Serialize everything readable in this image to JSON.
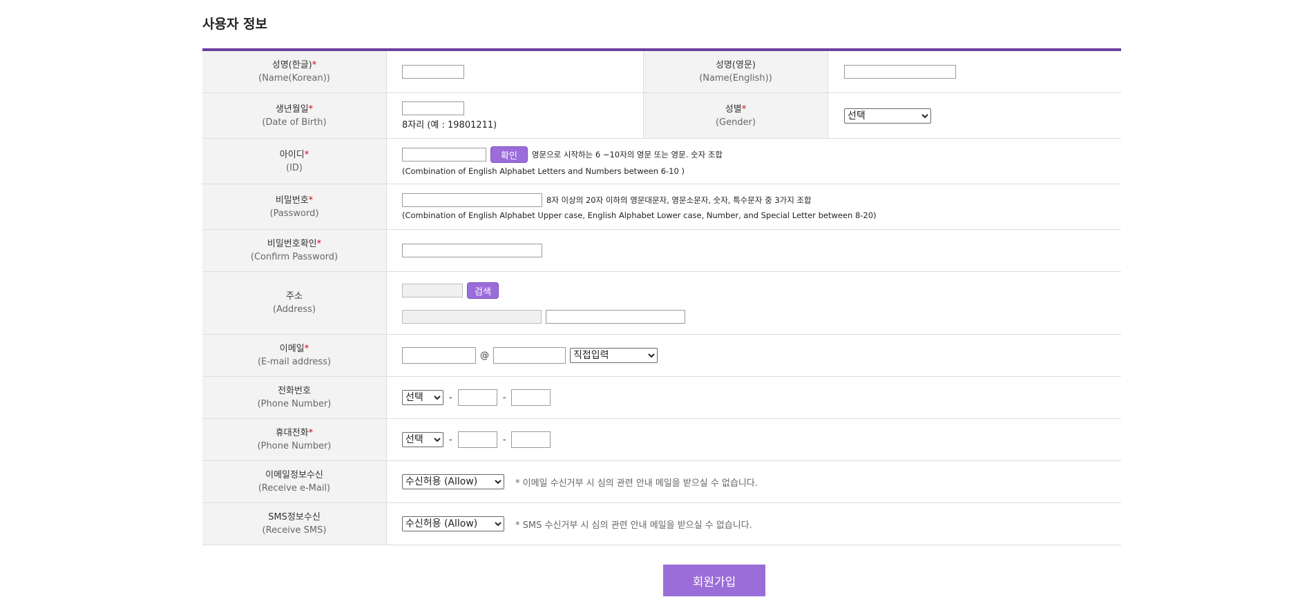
{
  "section_title": "사용자 정보",
  "required_mark": "*",
  "rows": {
    "name_kr": {
      "label": "성명(한글)",
      "en": "(Name(Korean))"
    },
    "name_en": {
      "label": "성명(영문)",
      "en": "(Name(English))"
    },
    "birth": {
      "label": "생년월일",
      "en": "(Date of Birth)",
      "hint": "8자리 (예 : 19801211)"
    },
    "gender": {
      "label": "성별",
      "en": "(Gender)",
      "selected": "선택"
    },
    "id": {
      "label": "아이디",
      "en": "(ID)",
      "button": "확인",
      "hint": "영문으로 시작하는 6 ~10자의 영문 또는 영문. 숫자 조합",
      "hint_en": "(Combination of English Alphabet Letters and Numbers between 6-10 )"
    },
    "password": {
      "label": "비밀번호",
      "en": "(Password)",
      "hint": "8자 이상의 20자 이하의 영문대문자, 영문소문자, 숫자, 특수문자 중 3가지 조합",
      "hint_en": "(Combination of English Alphabet Upper case, English Alphabet Lower case, Number, and Special Letter between 8-20)"
    },
    "confirm_password": {
      "label": "비밀번호확인",
      "en": "(Confirm Password)"
    },
    "address": {
      "label": "주소",
      "en": "(Address)",
      "button": "검색"
    },
    "email": {
      "label": "이메일",
      "en": "(E-mail address)",
      "at": "@",
      "domain_select": "직접입력"
    },
    "phone": {
      "label": "전화번호",
      "en": "(Phone Number)",
      "selected": "선택",
      "dash": "-"
    },
    "mobile": {
      "label": "휴대전화",
      "en": "(Phone Number)",
      "selected": "선택",
      "dash": "-"
    },
    "email_receive": {
      "label": "이메일정보수신",
      "en": "(Receive e-Mail)",
      "selected": "수신허용 (Allow)",
      "note": "* 이메일 수신거부 시 심의 관련 안내 메일을 받으실 수 없습니다."
    },
    "sms_receive": {
      "label": "SMS정보수신",
      "en": "(Receive SMS)",
      "selected": "수신허용 (Allow)",
      "note": "* SMS 수신거부 시 심의 관련 안내 메일을 받으실 수 없습니다."
    }
  },
  "submit_label": "회원가입",
  "colors": {
    "accent": "#6b3fa0",
    "button": "#9b6dd9",
    "required": "#d0021b"
  }
}
